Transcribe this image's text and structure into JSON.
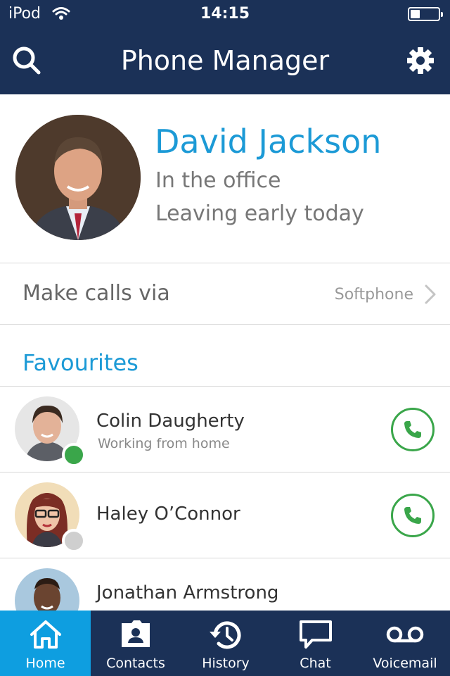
{
  "status_bar": {
    "carrier": "iPod",
    "time": "14:15",
    "battery_level": 0.35
  },
  "nav_bar": {
    "title": "Phone Manager",
    "left_icon": "search-icon",
    "right_icon": "gear-icon"
  },
  "profile": {
    "name": "David Jackson",
    "status": "In the office",
    "note": "Leaving early today"
  },
  "make_calls": {
    "label": "Make calls via",
    "value": "Softphone"
  },
  "favourites": {
    "title": "Favourites",
    "items": [
      {
        "name": "Colin Daugherty",
        "status": "Working from home",
        "presence": "available",
        "presence_color": "#3aa64a",
        "can_call": true
      },
      {
        "name": "Haley O’Connor",
        "status": "",
        "presence": "offline",
        "presence_color": "#cfcfcf",
        "can_call": true
      },
      {
        "name": "Jonathan Armstrong",
        "status": "",
        "presence": "",
        "can_call": false
      }
    ]
  },
  "tab_bar": {
    "tabs": [
      {
        "label": "Home",
        "icon": "home-icon",
        "active": true
      },
      {
        "label": "Contacts",
        "icon": "contacts-icon",
        "active": false
      },
      {
        "label": "History",
        "icon": "history-icon",
        "active": false
      },
      {
        "label": "Chat",
        "icon": "chat-icon",
        "active": false
      },
      {
        "label": "Voicemail",
        "icon": "voicemail-icon",
        "active": false
      }
    ]
  },
  "colors": {
    "navy": "#1b3157",
    "accent_blue": "#1c9ad6",
    "active_tab": "#0e9ee0",
    "call_green": "#3aa64a"
  }
}
